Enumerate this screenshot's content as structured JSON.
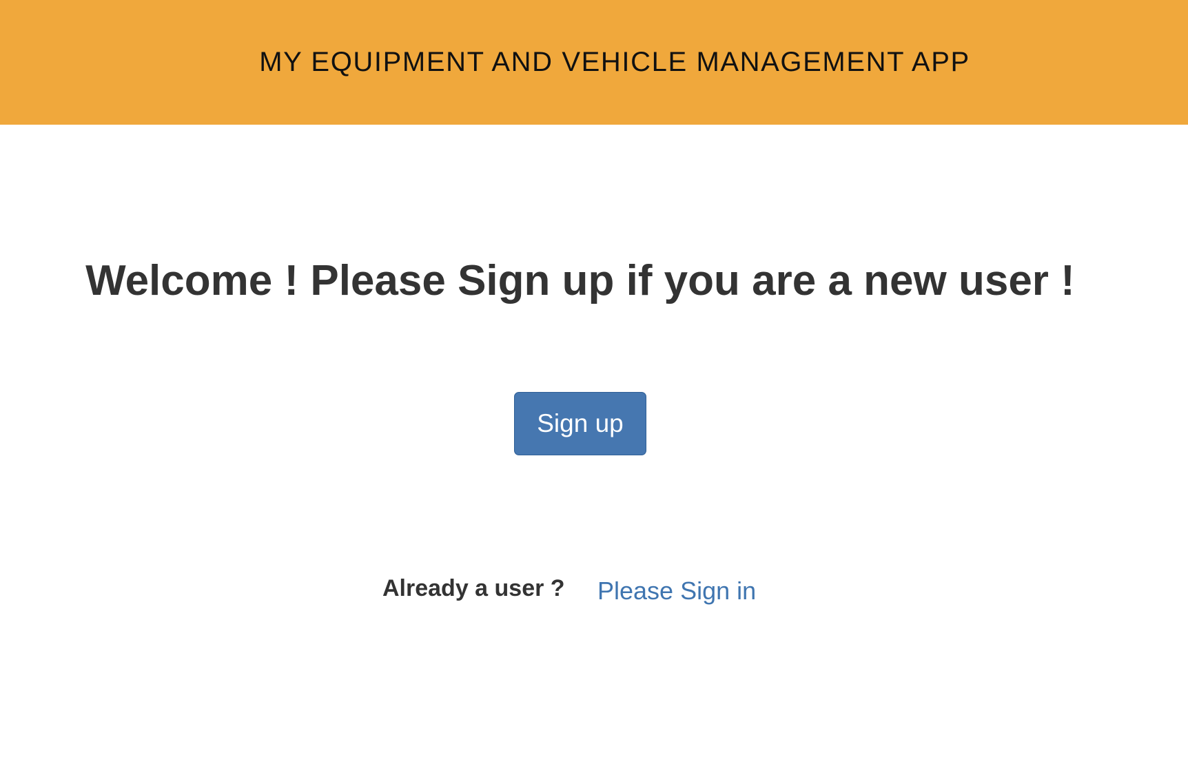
{
  "header": {
    "title": "MY EQUIPMENT AND VEHICLE MANAGEMENT APP",
    "background_color": "#f0a83c"
  },
  "main": {
    "welcome_text": "Welcome ! Please Sign up if you are a new user !",
    "signup_button_label": "Sign up",
    "signup_button_color": "#4677b0",
    "already_user_text": "Already a user ?",
    "signin_link_text": "Please Sign in",
    "link_color": "#3f75b0"
  }
}
